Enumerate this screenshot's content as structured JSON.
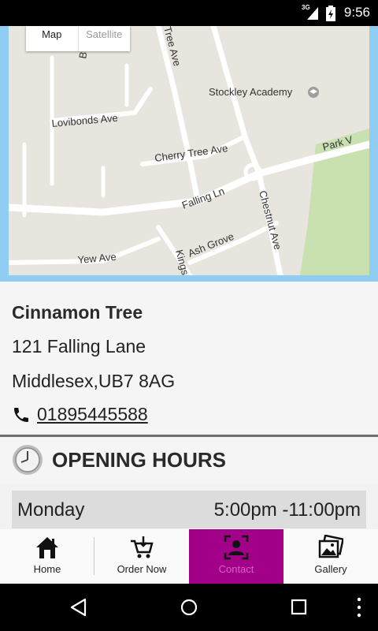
{
  "status_bar": {
    "time": "9:56",
    "network": "3G"
  },
  "map": {
    "toggle_map": "Map",
    "toggle_satellite": "Satellite",
    "labels": {
      "tree_ave": "Tree Ave",
      "stockley_academy": "Stockley Academy",
      "lovibonds_ave": "Lovibonds Ave",
      "cherry_tree_ave": "Cherry Tree Ave",
      "park": "Park V",
      "falling_ln": "Falling Ln",
      "chestnut_ave": "Chestnut Ave",
      "ash_grove": "Ash Grove",
      "yew_ave": "Yew Ave",
      "kings": "Kings",
      "b_label": "B"
    }
  },
  "restaurant": {
    "name": "Cinnamon Tree",
    "address_line1": "121 Falling Lane",
    "address_line2": "Middlesex,UB7 8AG",
    "phone": "01895445588"
  },
  "hours": {
    "title": "OPENING HOURS",
    "rows": [
      {
        "day": "Monday",
        "time": "5:00pm -11:00pm"
      }
    ]
  },
  "bottom_nav": {
    "items": [
      {
        "label": "Home",
        "icon": "home-icon"
      },
      {
        "label": "Order Now",
        "icon": "cart-icon"
      },
      {
        "label": "Contact",
        "icon": "contact-icon"
      },
      {
        "label": "Gallery",
        "icon": "gallery-icon"
      }
    ],
    "active_index": 2,
    "active_color": "#a3008a"
  },
  "colors": {
    "map_border": "#8fcdf2",
    "park_green": "#c9e0b0"
  }
}
